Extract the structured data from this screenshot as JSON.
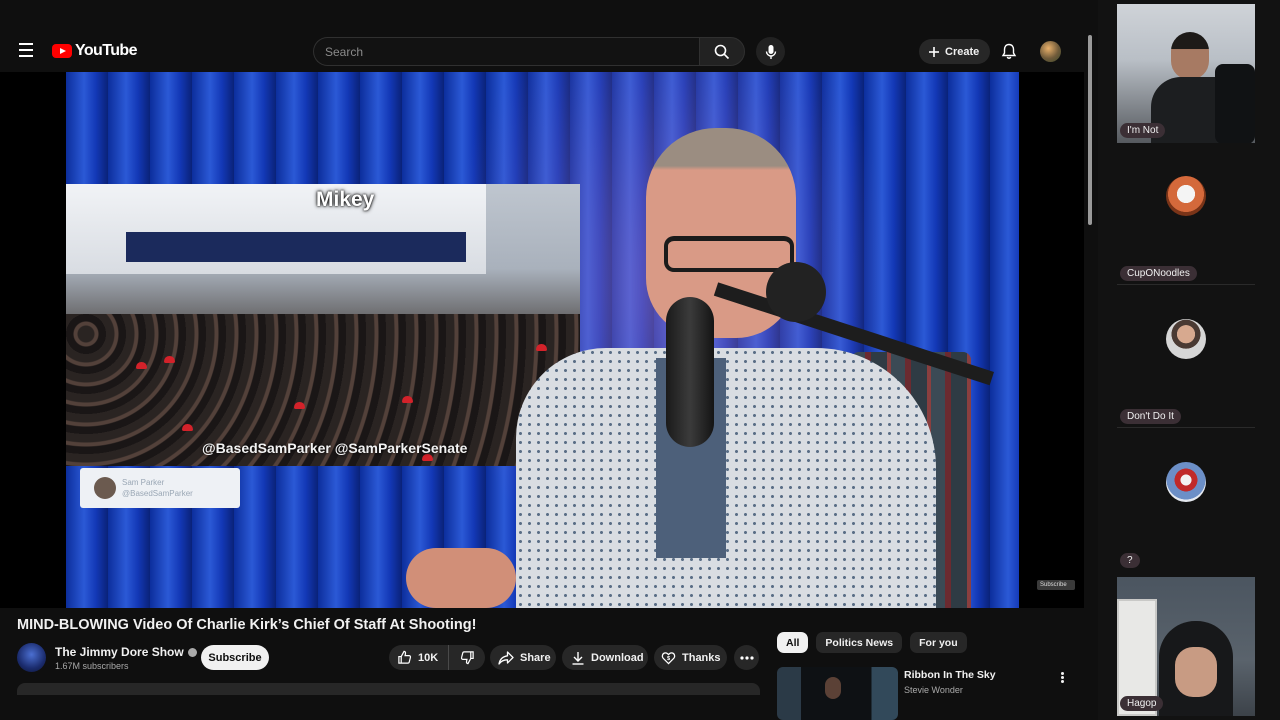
{
  "youtube": {
    "logo_text": "YouTube",
    "search": {
      "placeholder": "Search"
    },
    "create_label": "Create",
    "video": {
      "title": "MIND-BLOWING Video Of Charlie Kirk’s Chief Of Staff At Shooting!",
      "overlay_name": "Mikey",
      "overlay_handles": "@BasedSamParker @SamParkerSenate",
      "tag_card_name": "Sam Parker",
      "tag_card_handle": "@BasedSamParker",
      "watermark": "Subscribe"
    },
    "channel": {
      "name": "The Jimmy Dore Show",
      "subscribers": "1.67M subscribers",
      "subscribe_label": "Subscribe"
    },
    "actions": {
      "likes": "10K",
      "share_label": "Share",
      "download_label": "Download",
      "thanks_label": "Thanks"
    },
    "chips": [
      "All",
      "Politics News",
      "For you"
    ],
    "recommendation": {
      "title": "Ribbon In The Sky",
      "artist": "Stevie Wonder"
    }
  },
  "participants": [
    {
      "name": "I'm Not",
      "type": "video"
    },
    {
      "name": "CupONoodles",
      "type": "avatar",
      "avatar": "red-panda-avatar"
    },
    {
      "name": "Don't Do It",
      "type": "avatar",
      "avatar": "man-avatar"
    },
    {
      "name": "?",
      "type": "avatar",
      "avatar": "religious-figure-avatar"
    },
    {
      "name": "Hagop",
      "type": "video"
    }
  ],
  "colors": {
    "background": "#0f0f0f",
    "logo_red": "#ff0000",
    "pill": "#272727",
    "name_tag": "#3b2f35"
  }
}
